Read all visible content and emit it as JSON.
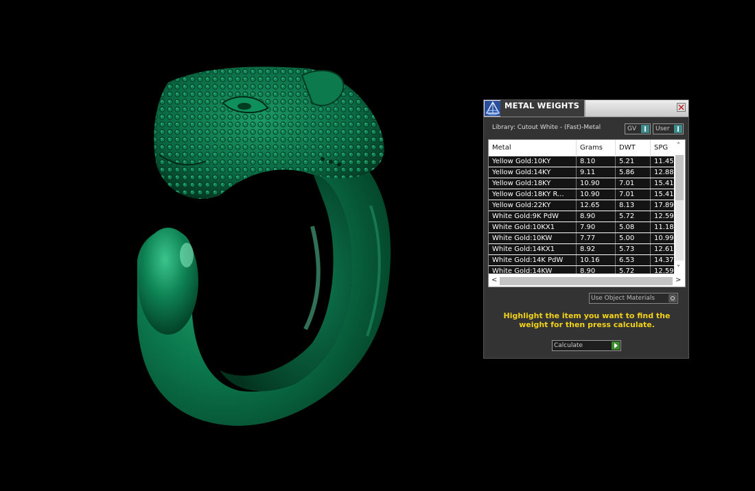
{
  "window": {
    "title": "METAL WEIGHTS"
  },
  "library": {
    "label": "Library: Cutout White - (Fast)-Metal"
  },
  "toggles": [
    {
      "label": "GV"
    },
    {
      "label": "User"
    }
  ],
  "table": {
    "headers": [
      "Metal",
      "Grams",
      "DWT",
      "SPG"
    ],
    "rows": [
      [
        "Yellow Gold:10KY",
        "8.10",
        "5.21",
        "11.45"
      ],
      [
        "Yellow Gold:14KY",
        "9.11",
        "5.86",
        "12.88"
      ],
      [
        "Yellow Gold:18KY",
        "10.90",
        "7.01",
        "15.41"
      ],
      [
        "Yellow Gold:18KY R...",
        "10.90",
        "7.01",
        "15.41"
      ],
      [
        "Yellow Gold:22KY",
        "12.65",
        "8.13",
        "17.89"
      ],
      [
        "White Gold:9K PdW",
        "8.90",
        "5.72",
        "12.59"
      ],
      [
        "White Gold:10KX1",
        "7.90",
        "5.08",
        "11.18"
      ],
      [
        "White Gold:10KW",
        "7.77",
        "5.00",
        "10.99"
      ],
      [
        "White Gold:14KX1",
        "8.92",
        "5.73",
        "12.61"
      ],
      [
        "White Gold:14K PdW",
        "10.16",
        "6.53",
        "14.37"
      ],
      [
        "White Gold:14KW",
        "8.90",
        "5.72",
        "12.59"
      ]
    ]
  },
  "use_object_materials": {
    "label": "Use Object Materials"
  },
  "instruction": "Highlight the item you want to find the weight for then press calculate.",
  "calculate": {
    "label": "Calculate"
  },
  "icons": {
    "logo": "app-logo-icon",
    "close": "close-icon"
  },
  "colors": {
    "ring": "#0b6b45",
    "instruction": "#f2d21a",
    "accent": "#3c8c8c"
  }
}
